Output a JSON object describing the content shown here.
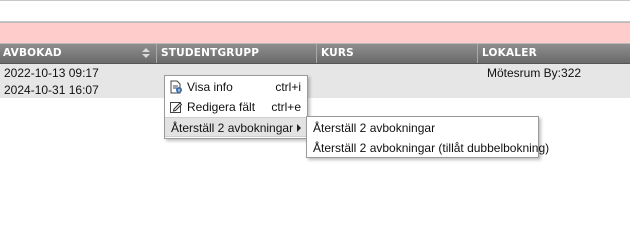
{
  "table": {
    "columns": [
      {
        "label": "AVBOKAD",
        "sortable": true
      },
      {
        "label": "STUDENTGRUPP"
      },
      {
        "label": "KURS"
      },
      {
        "label": "LOKALER"
      }
    ],
    "row": {
      "avbokad_1": "2022-10-13 09:17",
      "avbokad_2": "2024-10-31 16:07",
      "lokaler": "Mötesrum By:322"
    }
  },
  "context_menu": {
    "items": [
      {
        "label": "Visa info",
        "shortcut": "ctrl+i",
        "icon": "info-document-icon"
      },
      {
        "label": "Redigera fält",
        "shortcut": "ctrl+e",
        "icon": "edit-icon"
      },
      {
        "label": "Återställ 2 avbokningar",
        "has_submenu": true
      }
    ],
    "submenu": [
      {
        "label": "Återställ 2 avbokningar"
      },
      {
        "label": "Återställ 2 avbokningar (tillåt dubbelbokning)"
      }
    ]
  },
  "colors": {
    "alert_bar": "#ffcccc",
    "header_bg": "#777777",
    "row_bg": "#e6e6e6"
  }
}
